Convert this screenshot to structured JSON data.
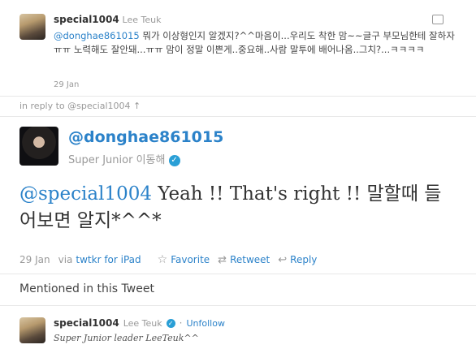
{
  "parent_tweet": {
    "username": "special1004",
    "realname": "Lee Teuk",
    "mention": "@donghae861015",
    "text": " 뭐가 이상형인지 알겠지?^^마음이...우리도 착한 맘~~글구 부모님한테 잘하자 ㅠㅠ 노력해도 잘안돼...ㅠㅠ 맘이 정말 이쁜게..중요해..사람 말투에 배어나옴..그치?...ㅋㅋㅋㅋ",
    "timestamp": "29 Jan"
  },
  "in_reply_to": "in reply to @special1004 ↑",
  "main_tweet": {
    "username": "@donghae861015",
    "realname": "Super Junior 이동해",
    "mention": "@special1004",
    "text": " Yeah !! That's right !! 말할때 들어보면 알지*^^*",
    "timestamp": "29 Jan",
    "via": "via",
    "client": "twtkr for iPad",
    "favorite_label": "Favorite",
    "retweet_label": "Retweet",
    "reply_label": "Reply"
  },
  "mentioned_heading": "Mentioned in this Tweet",
  "mentioned_user": {
    "username": "special1004",
    "realname": "Lee Teuk",
    "unfollow_label": "Unfollow",
    "bio": "Super Junior leader LeeTeuk^^"
  },
  "icons": [
    "reply-corner-icon",
    "verified-icon",
    "star-icon",
    "retweet-icon",
    "reply-arrow-icon"
  ],
  "colors": {
    "link": "#2b82c9",
    "meta": "#999999",
    "verified": "#2a9fd6"
  }
}
